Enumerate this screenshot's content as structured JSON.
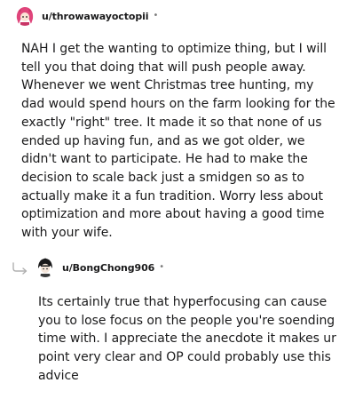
{
  "comments": [
    {
      "username": "u/throwawayoctopii",
      "separator": "•",
      "avatar_icon": "pink-haired-avatar-icon",
      "body": "NAH I get the wanting to optimize thing, but I will tell you that doing that will push people away. Whenever we went Christmas tree hunting, my dad would spend hours on the farm looking for the exactly \"right\" tree. It made it so that none of us ended up having fun, and as we got older, we didn't want to participate. He had to make the decision to scale back just a smidgen so as to actually make it a fun tradition. Worry less about optimization and more about having a good time with your wife."
    },
    {
      "username": "u/BongChong906",
      "separator": "•",
      "avatar_icon": "black-haired-avatar-icon",
      "reply_icon": "reply-arrow-icon",
      "body": "Its certainly true that hyperfocusing can cause you to lose focus on the people you're soending time with. I appreciate the anecdote it makes ur point very clear and OP could probably use this advice"
    }
  ],
  "colors": {
    "text": "#1a1a1b",
    "meta": "#7c7c7c",
    "accent_pink": "#e0457b"
  }
}
